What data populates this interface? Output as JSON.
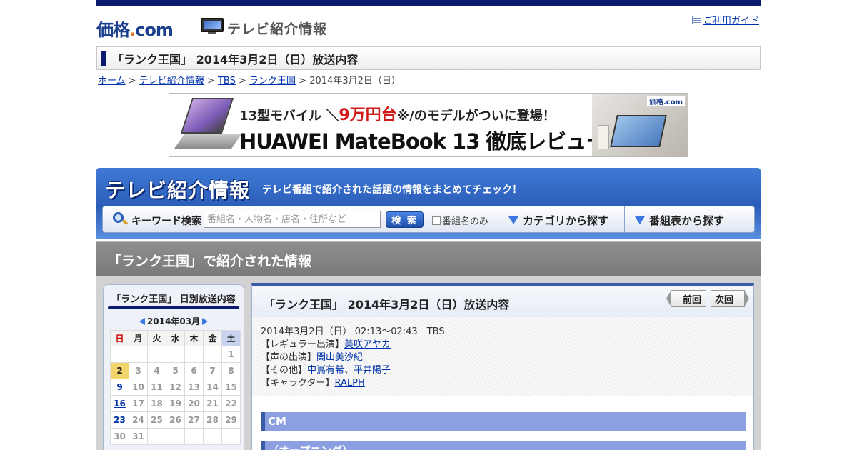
{
  "header": {
    "logo_main": "価格",
    "logo_dot": ".",
    "logo_com": "com",
    "site_title": "テレビ紹介情報",
    "guide_link": "ご利用ガイド"
  },
  "page_title": "「ランク王国」 2014年3月2日（日）放送内容",
  "breadcrumb": {
    "home": "ホーム",
    "sep": " > ",
    "tv": "テレビ紹介情報",
    "station": "TBS",
    "program": "ランク王国",
    "current": "2014年3月2日（日）"
  },
  "banner": {
    "line1_pre": "13型モバイル ＼",
    "line1_price": "9万円台",
    "line1_post": "※/のモデルがついに登場！",
    "line2": "HUAWEI MateBook 13 徹底レビュー",
    "brand": "価格.com"
  },
  "blue_header": {
    "big_title": "テレビ紹介情報",
    "subtitle": "テレビ番組で紹介された話題の情報をまとめてチェック！"
  },
  "search": {
    "label": "キーワード検索",
    "placeholder": "番組名・人物名・店名・住所など",
    "button": "検 索",
    "checkbox_label": "番組名のみ",
    "category": "カテゴリから探す",
    "schedule": "番組表から探す"
  },
  "section_title": "「ランク王国」で紹介された情報",
  "calendar": {
    "title": "「ランク王国」 日別放送内容",
    "month": "2014年03月",
    "weekdays": [
      "日",
      "月",
      "火",
      "水",
      "木",
      "金",
      "土"
    ],
    "weeks": [
      [
        "",
        "",
        "",
        "",
        "",
        "",
        "1"
      ],
      [
        "2",
        "3",
        "4",
        "5",
        "6",
        "7",
        "8"
      ],
      [
        "9",
        "10",
        "11",
        "12",
        "13",
        "14",
        "15"
      ],
      [
        "16",
        "17",
        "18",
        "19",
        "20",
        "21",
        "22"
      ],
      [
        "23",
        "24",
        "25",
        "26",
        "27",
        "28",
        "29"
      ],
      [
        "30",
        "31",
        "",
        "",
        "",
        "",
        ""
      ]
    ],
    "linked_days": [
      "9",
      "16",
      "23"
    ],
    "today": "2"
  },
  "main": {
    "title": "「ランク王国」 2014年3月2日（日）放送内容",
    "prev": "前回",
    "next": "次回",
    "broadcast": "2014年3月2日（日） 02:13～02:43　TBS",
    "regular_label": "【レギュラー出演】",
    "regular": "美咲アヤカ",
    "voice_label": "【声の出演】",
    "voice": "関山美沙紀",
    "other_label": "【その他】",
    "other1": "中嶌有希",
    "other_sep": "、",
    "other2": "平井陽子",
    "character_label": "【キャラクター】",
    "character": "RALPH",
    "segments": [
      "CM",
      "（オープニング）"
    ]
  },
  "colors": {
    "navy": "#0b1a6e",
    "link": "#0033aa",
    "blue_header": "#2a5db8",
    "segment": "#8c9fe0",
    "today": "#f3d66b"
  }
}
